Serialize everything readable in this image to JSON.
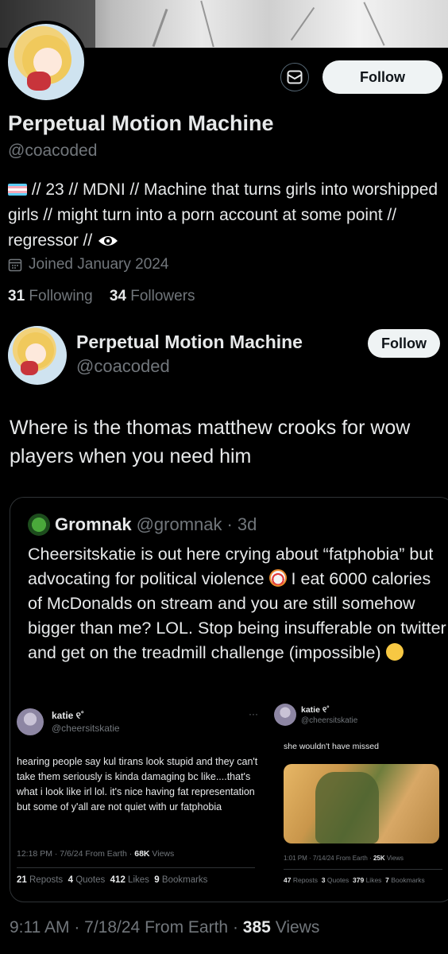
{
  "profile": {
    "name": "Perpetual Motion Machine",
    "handle": "@coacoded",
    "bio_text": " // 23 // MDNI // Machine that turns girls into worshipped girls // might turn into a porn account at some point // regressor // ",
    "joined": "Joined January 2024",
    "following_count": "31",
    "following_label": "Following",
    "followers_count": "34",
    "followers_label": "Followers",
    "follow_label": "Follow"
  },
  "tweet": {
    "author_name": "Perpetual Motion Machine",
    "author_handle": "@coacoded",
    "follow_label": "Follow",
    "text": "Where is the thomas matthew crooks for wow players when you need him",
    "time": "9:11 AM",
    "date": "7/18/24",
    "source": "From Earth",
    "views_count": "385",
    "views_label": "Views"
  },
  "quote": {
    "name": "Gromnak",
    "handle": "@gromnak",
    "age": "3d",
    "text_1": "Cheersitskatie is out here crying about “fatphobia” but advocating for political violence ",
    "text_2": " I eat 6000 calories of McDonalds on stream and you are still somehow bigger than me? LOL. Stop being insufferable on twitter and get on the treadmill challenge (impossible) ",
    "screenshot_left": {
      "name": "katie ୧˚",
      "handle": "@cheersitskatie",
      "text": "hearing people say kul tirans look stupid and they can't take them seriously is kinda damaging bc like....that's what i look like irl lol. it's nice having fat representation but some of y'all are not quiet with ur fatphobia",
      "meta_time": "12:18 PM · 7/6/24 From Earth · ",
      "meta_views": "68K",
      "meta_views_label": " Views",
      "reposts": "21",
      "reposts_label": "Reposts",
      "quotes": "4",
      "quotes_label": "Quotes",
      "likes": "412",
      "likes_label": "Likes",
      "bookmarks": "9",
      "bookmarks_label": "Bookmarks"
    },
    "screenshot_right": {
      "name": "katie ୧˚",
      "handle": "@cheersitskatie",
      "text": "she wouldn't have missed",
      "meta_time": "1:01 PM · 7/14/24 From Earth · ",
      "meta_views": "25K",
      "meta_views_label": " Views",
      "reposts": "47",
      "reposts_label": "Reposts",
      "quotes": "3",
      "quotes_label": "Quotes",
      "likes": "379",
      "likes_label": "Likes",
      "bookmarks": "7",
      "bookmarks_label": "Bookmarks"
    }
  },
  "icons": {
    "message": "envelope-icon",
    "calendar": "calendar-icon",
    "trans_flag": "trans-flag-icon",
    "eye": "eye-icon",
    "clown": "clown-emoji-icon",
    "shush": "face-hand-over-mouth-icon"
  },
  "colors": {
    "background": "#000000",
    "text": "#e7e9ea",
    "muted": "#71767b",
    "button_bg": "#eff3f4",
    "border": "#2f3336"
  }
}
